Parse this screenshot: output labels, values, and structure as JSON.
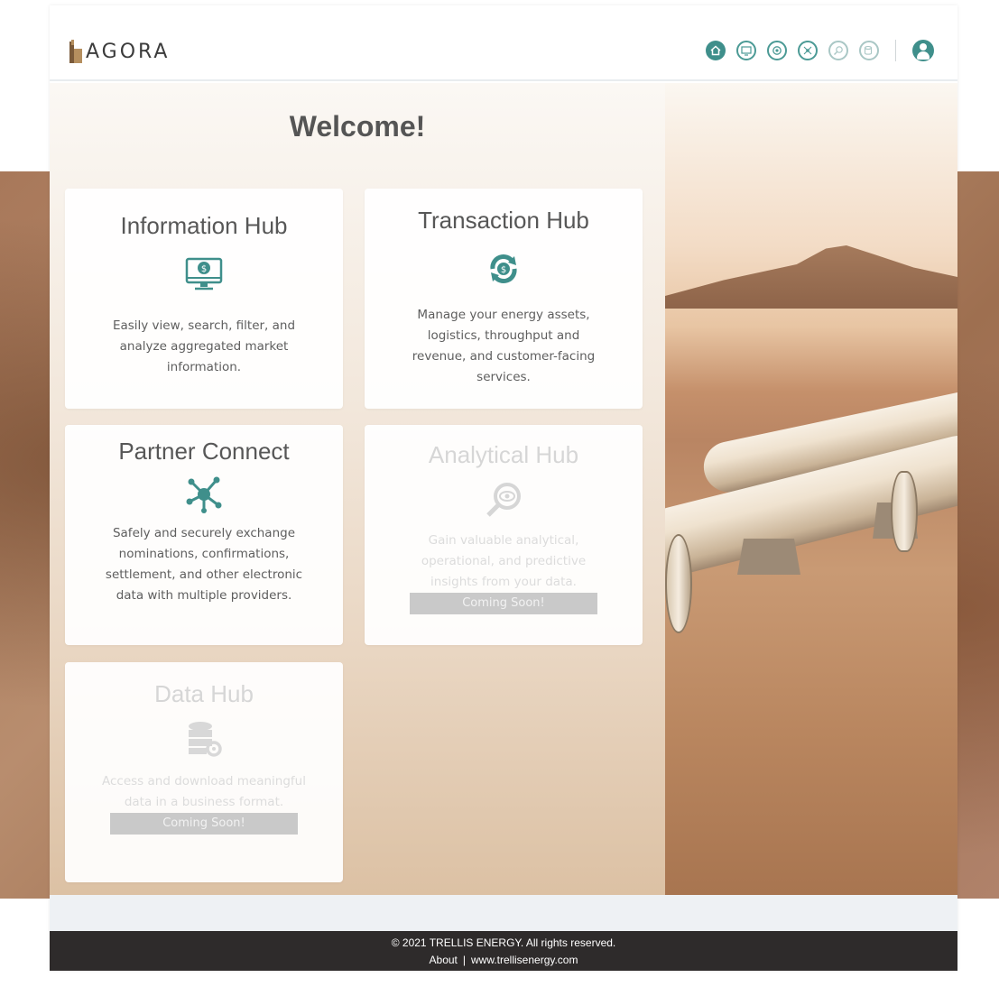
{
  "brand": {
    "name": "AGORA"
  },
  "nav": {
    "items": [
      {
        "name": "home",
        "icon": "home-icon",
        "state": "active"
      },
      {
        "name": "information-hub",
        "icon": "monitor-dollar-icon",
        "state": "normal"
      },
      {
        "name": "transaction-hub",
        "icon": "dollar-cycle-icon",
        "state": "normal"
      },
      {
        "name": "partner-connect",
        "icon": "network-icon",
        "state": "normal"
      },
      {
        "name": "analytical-hub",
        "icon": "search-eye-icon",
        "state": "dim"
      },
      {
        "name": "data-hub",
        "icon": "database-gear-icon",
        "state": "dim"
      }
    ],
    "user_icon": "user-icon"
  },
  "welcome": "Welcome!",
  "cards": {
    "info": {
      "title": "Information Hub",
      "icon": "monitor-dollar-icon",
      "desc": "Easily view, search, filter, and analyze aggregated market information."
    },
    "trans": {
      "title": "Transaction Hub",
      "icon": "dollar-cycle-icon",
      "desc": "Manage your energy assets, logistics, throughput and revenue, and customer-facing services."
    },
    "partner": {
      "title": "Partner Connect",
      "icon": "network-icon",
      "desc": "Safely and securely exchange nominations, confirmations, settlement, and other electronic data with multiple providers."
    },
    "analyt": {
      "title": "Analytical Hub",
      "icon": "search-eye-icon",
      "desc": "Gain valuable analytical, operational, and predictive insights from your data.",
      "badge": "Coming Soon!"
    },
    "data": {
      "title": "Data Hub",
      "icon": "database-gear-icon",
      "desc": "Access and download meaningful data in a business format.",
      "badge": "Coming Soon!"
    }
  },
  "footer": {
    "copyright": "© 2021 TRELLIS ENERGY. All rights reserved.",
    "about": "About",
    "separator": "|",
    "website": "www.trellisenergy.com"
  },
  "colors": {
    "accent": "#3f8f8b",
    "footer_bg": "#2e2b2b",
    "strip_bg": "#eef1f4"
  }
}
